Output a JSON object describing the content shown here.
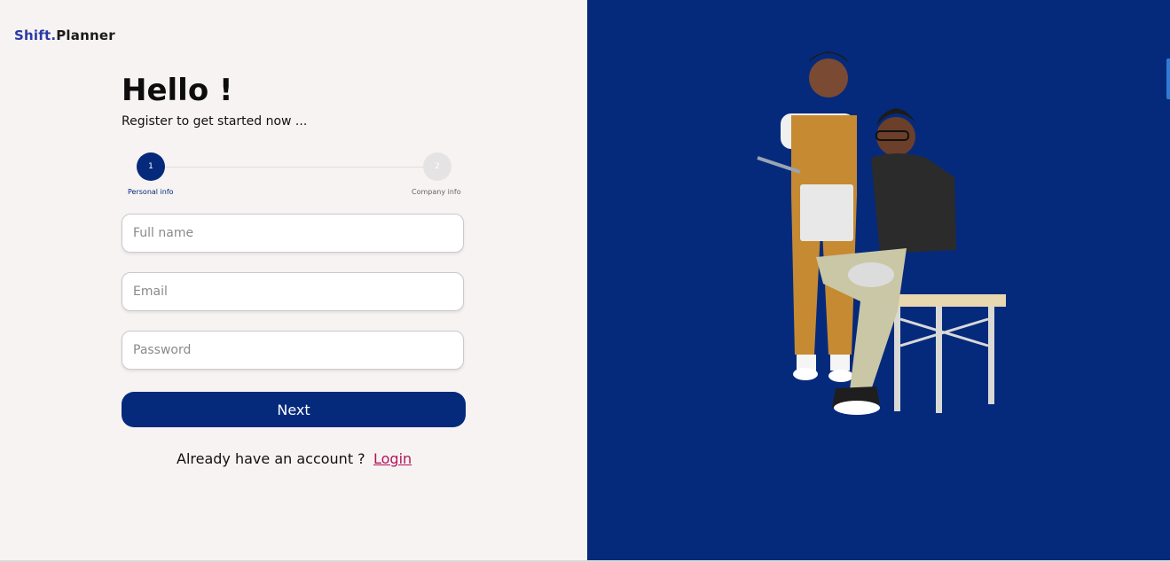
{
  "logo": {
    "part1": "Shift.",
    "part2": "Planner"
  },
  "heading": {
    "title": "Hello !",
    "subtitle": "Register to get started now ..."
  },
  "stepper": {
    "steps": [
      {
        "number": "1",
        "label": "Personal info",
        "active": true
      },
      {
        "number": "2",
        "label": "Company info",
        "active": false
      }
    ]
  },
  "form": {
    "fullname_placeholder": "Full name",
    "email_placeholder": "Email",
    "password_placeholder": "Password",
    "next_label": "Next"
  },
  "footer": {
    "prompt": "Already have an account ?",
    "login_label": "Login"
  },
  "colors": {
    "brand": "#052a7c",
    "panel_bg": "#f7f3f2",
    "link": "#b3135a",
    "logo_accent": "#2a3aa6"
  },
  "illustration": {
    "icon": "people-at-work-illustration"
  }
}
